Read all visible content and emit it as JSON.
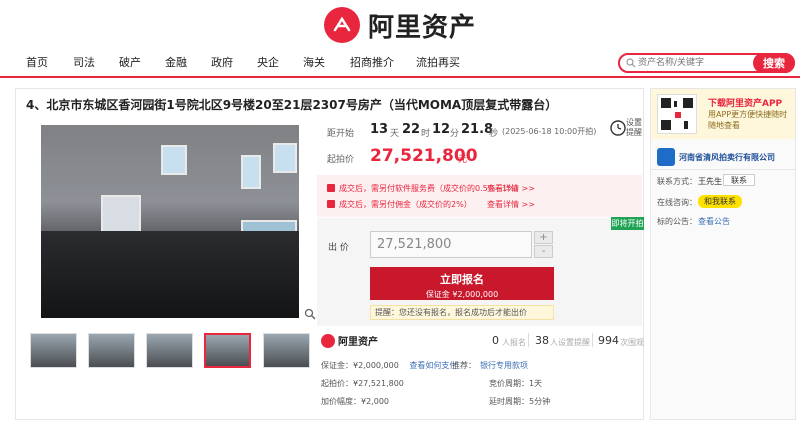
{
  "brand": {
    "name": "阿里资产"
  },
  "nav": {
    "items": [
      "首页",
      "司法",
      "破产",
      "金融",
      "政府",
      "央企",
      "海关",
      "招商推介",
      "流拍再买"
    ]
  },
  "search": {
    "placeholder": "资产名称/关键字",
    "button": "搜索"
  },
  "listing": {
    "title": "4、北京市东城区香河园街1号院北区9号楼20至21层2307号房产（当代MOMA顶层复式带露台）",
    "countdown_label": "距开始",
    "countdown": {
      "days": "13",
      "days_unit": "天",
      "hours": "22",
      "hours_unit": "时",
      "minutes": "12",
      "minutes_unit": "分",
      "seconds": "21.8",
      "seconds_unit": "秒"
    },
    "start_time": "(2025-06-18 10:00开拍)",
    "start_price_label": "起拍价",
    "start_price": "27,521,800",
    "start_price_unit": "元",
    "remind_label": "设置 提醒",
    "notices": [
      {
        "text": "成交后，需另付软件服务费（成交价的0.5%~1%）",
        "link": "查看详情 >>"
      },
      {
        "text": "成交后，需另付佣金（成交价的2%）",
        "link": "查看详情 >>"
      }
    ],
    "instant_badge": "即将开拍",
    "bid_label": "出 价",
    "bid_value": "27,521,800",
    "step_plus": "+",
    "step_minus": "-",
    "apply_button": "立即报名",
    "deposit_text": "保证金 ¥2,000,000",
    "reminder": "提醒：您还没有报名，报名成功后才能出价",
    "stats": [
      {
        "num": "0",
        "label": "人报名"
      },
      {
        "num": "38",
        "label": "人设置提醒"
      },
      {
        "num": "994",
        "label": "次围观"
      }
    ],
    "info": {
      "deposit_label": "保证金：",
      "deposit_value": "¥2,000,000",
      "deposit_link": "查看如何支付",
      "recommend_label": "推荐：",
      "recommend_value": "银行专用款项",
      "start_price_label": "起拍价：",
      "start_price_value": "¥27,521,800",
      "bid_cycle_label": "竞价周期：",
      "bid_cycle_value": "1天",
      "increment_label": "加价幅度：",
      "increment_value": "¥2,000",
      "delay_label": "延时周期：",
      "delay_value": "5分钟"
    }
  },
  "side": {
    "app_title": "下载阿里资产APP",
    "app_desc": "用APP更方便快捷随时随地查看",
    "org_name": "河南省清风拍卖行有限公司",
    "contact_label": "联系方式：",
    "contact_name": "王先生",
    "contact_button": "联系",
    "online_label": "在线咨询：",
    "online_button": "和我联系",
    "notice_label": "标的公告：",
    "notice_link": "查看公告"
  },
  "colors": {
    "accent": "#e8263d",
    "green": "#21a355",
    "link": "#3b6fb6"
  }
}
